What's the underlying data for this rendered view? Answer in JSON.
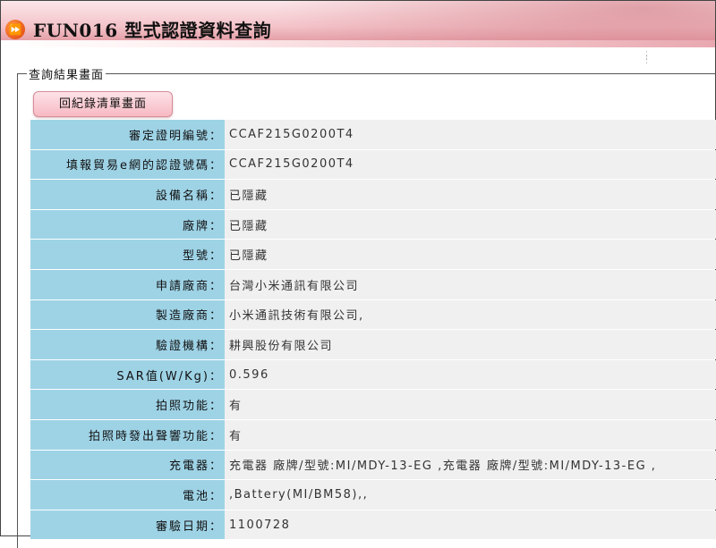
{
  "header": {
    "icon": "fast-forward-icon",
    "title": "FUN016 型式認證資料查詢"
  },
  "panel": {
    "legend": "查詢結果畫面",
    "back_button_label": "回紀錄清單畫面"
  },
  "colors": {
    "label_bg": "#9ed3e6",
    "value_bg": "#f0f0f0",
    "button_bg": "#f7b9c3",
    "header_accent": "#dd8d96"
  },
  "rows": [
    {
      "label": "審定證明編號：",
      "value": "CCAF215G0200T4"
    },
    {
      "label": "填報貿易e網的認證號碼：",
      "value": "CCAF215G0200T4"
    },
    {
      "label": "設備名稱：",
      "value": "已隱藏"
    },
    {
      "label": "廠牌：",
      "value": "已隱藏"
    },
    {
      "label": "型號：",
      "value": "已隱藏"
    },
    {
      "label": "申請廠商：",
      "value": "台灣小米通訊有限公司"
    },
    {
      "label": "製造廠商：",
      "value": "小米通訊技術有限公司,"
    },
    {
      "label": "驗證機構：",
      "value": "耕興股份有限公司"
    },
    {
      "label": "SAR值(W/Kg)：",
      "value": "0.596"
    },
    {
      "label": "拍照功能：",
      "value": "有"
    },
    {
      "label": "拍照時發出聲響功能：",
      "value": "有"
    },
    {
      "label": "充電器：",
      "value": "充電器 廠牌/型號:MI/MDY-13-EG ,充電器 廠牌/型號:MI/MDY-13-EG ,"
    },
    {
      "label": "電池：",
      "value": ",Battery(MI/BM58),,"
    },
    {
      "label": "審驗日期：",
      "value": "1100728"
    }
  ]
}
